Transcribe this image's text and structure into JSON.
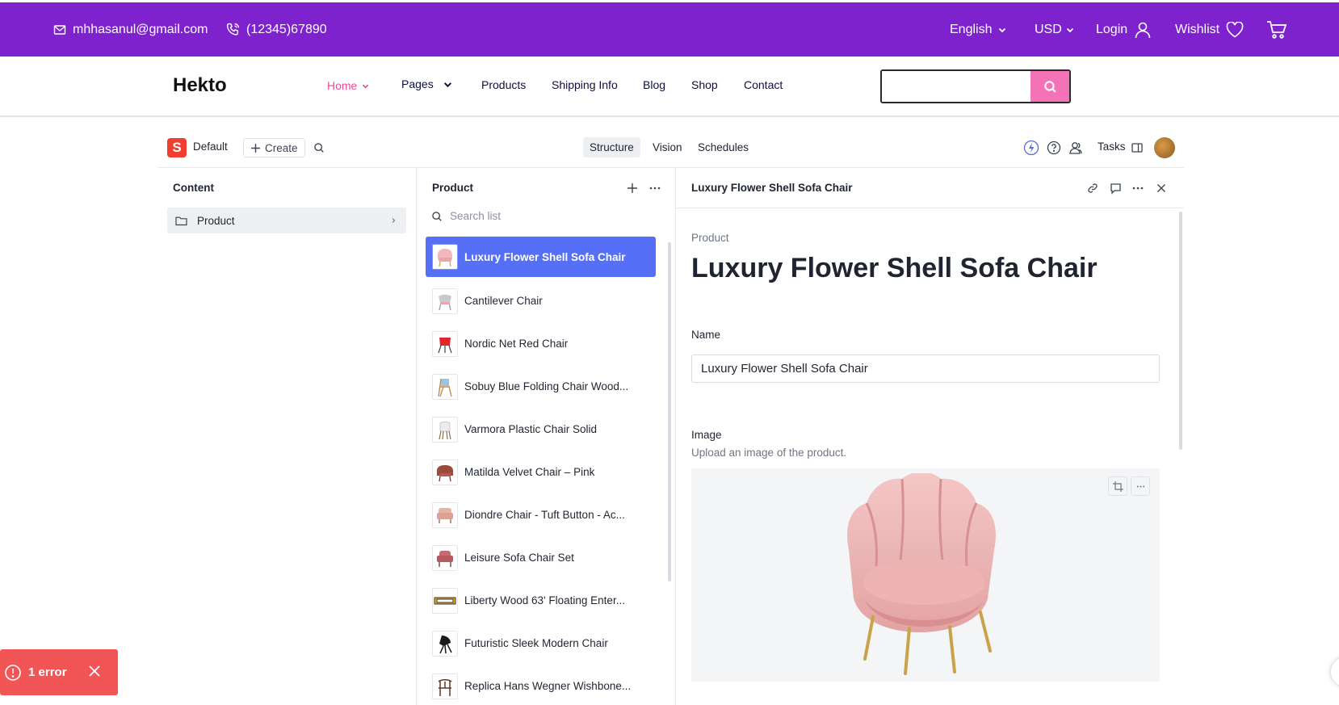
{
  "topbar": {
    "email": "mhhasanul@gmail.com",
    "phone": "(12345)67890",
    "language": "English",
    "currency": "USD",
    "login": "Login",
    "wishlist": "Wishlist"
  },
  "site_nav": {
    "logo": "Hekto",
    "links": [
      "Home",
      "Pages",
      "Products",
      "Shipping Info",
      "Blog",
      "Shop",
      "Contact"
    ],
    "search_value": ""
  },
  "studio": {
    "workspace": "Default",
    "create": "Create",
    "tabs": [
      "Structure",
      "Vision",
      "Schedules"
    ],
    "active_tab": "Structure",
    "tasks": "Tasks"
  },
  "content_pane": {
    "title": "Content",
    "items": [
      "Product"
    ]
  },
  "product_pane": {
    "title": "Product",
    "search_placeholder": "Search list",
    "items": [
      "Luxury Flower Shell Sofa Chair",
      "Cantilever Chair",
      "Nordic Net Red Chair",
      "Sobuy Blue Folding Chair Wood...",
      "Varmora Plastic Chair Solid",
      "Matilda Velvet Chair – Pink",
      "Diondre Chair - Tuft Button - Ac...",
      "Leisure Sofa Chair Set",
      "Liberty Wood 63' Floating Enter...",
      "Futuristic Sleek Modern Chair",
      "Replica Hans Wegner Wishbone..."
    ],
    "selected_index": 0
  },
  "document": {
    "header_title": "Luxury Flower Shell Sofa Chair",
    "type_label": "Product",
    "title": "Luxury Flower Shell Sofa Chair",
    "name_label": "Name",
    "name_value": "Luxury Flower Shell Sofa Chair",
    "image_label": "Image",
    "image_description": "Upload an image of the product."
  },
  "toast": {
    "text": "1 error"
  },
  "colors": {
    "topbar": "#7e22ce",
    "active_nav": "#ec4899",
    "selected_item": "#556ff6",
    "error": "#f25555"
  }
}
